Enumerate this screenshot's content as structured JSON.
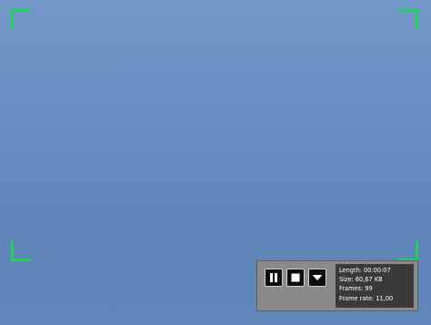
{
  "colors": {
    "frame_corners": "#1fd35a",
    "background_top": "#7398c9",
    "background_bottom": "#5f84b8",
    "toolbar_bg": "#8a8a8a",
    "info_bg": "#3a3a3a"
  },
  "toolbar": {
    "buttons": [
      {
        "icon": "pause-icon"
      },
      {
        "icon": "stop-icon"
      },
      {
        "icon": "dropdown-arrow-icon"
      }
    ],
    "info": {
      "length": "Length: 00:00:07",
      "size": "Size: 60,67 KB",
      "frames": "Frames: 99",
      "frame_rate": "Frame rate: 11,00"
    }
  }
}
